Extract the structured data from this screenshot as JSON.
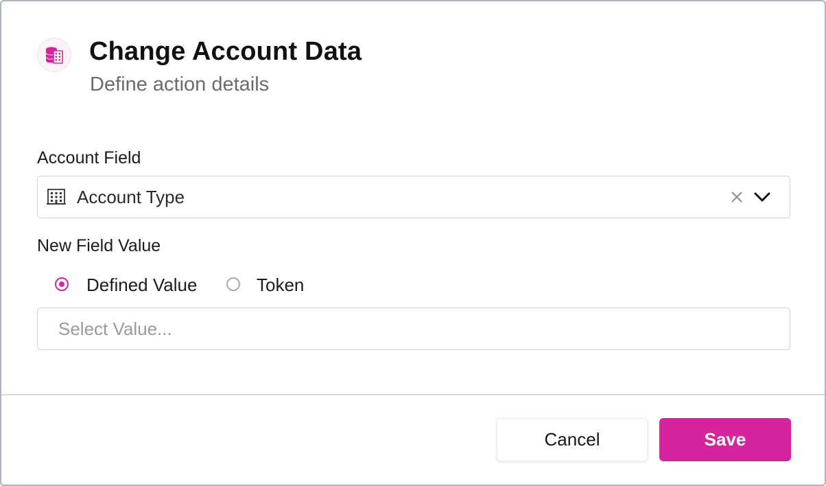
{
  "dialog": {
    "title": "Change Account Data",
    "subtitle": "Define action details",
    "icon": "database-building-icon",
    "accent_color": "#d6249f"
  },
  "account_field": {
    "label": "Account Field",
    "selected_value": "Account Type",
    "icon": "building-icon"
  },
  "new_field_value": {
    "label": "New Field Value",
    "options": [
      {
        "label": "Defined Value",
        "checked": true
      },
      {
        "label": "Token",
        "checked": false
      }
    ],
    "value_input": {
      "placeholder": "Select Value...",
      "value": ""
    }
  },
  "footer": {
    "cancel_label": "Cancel",
    "save_label": "Save"
  }
}
